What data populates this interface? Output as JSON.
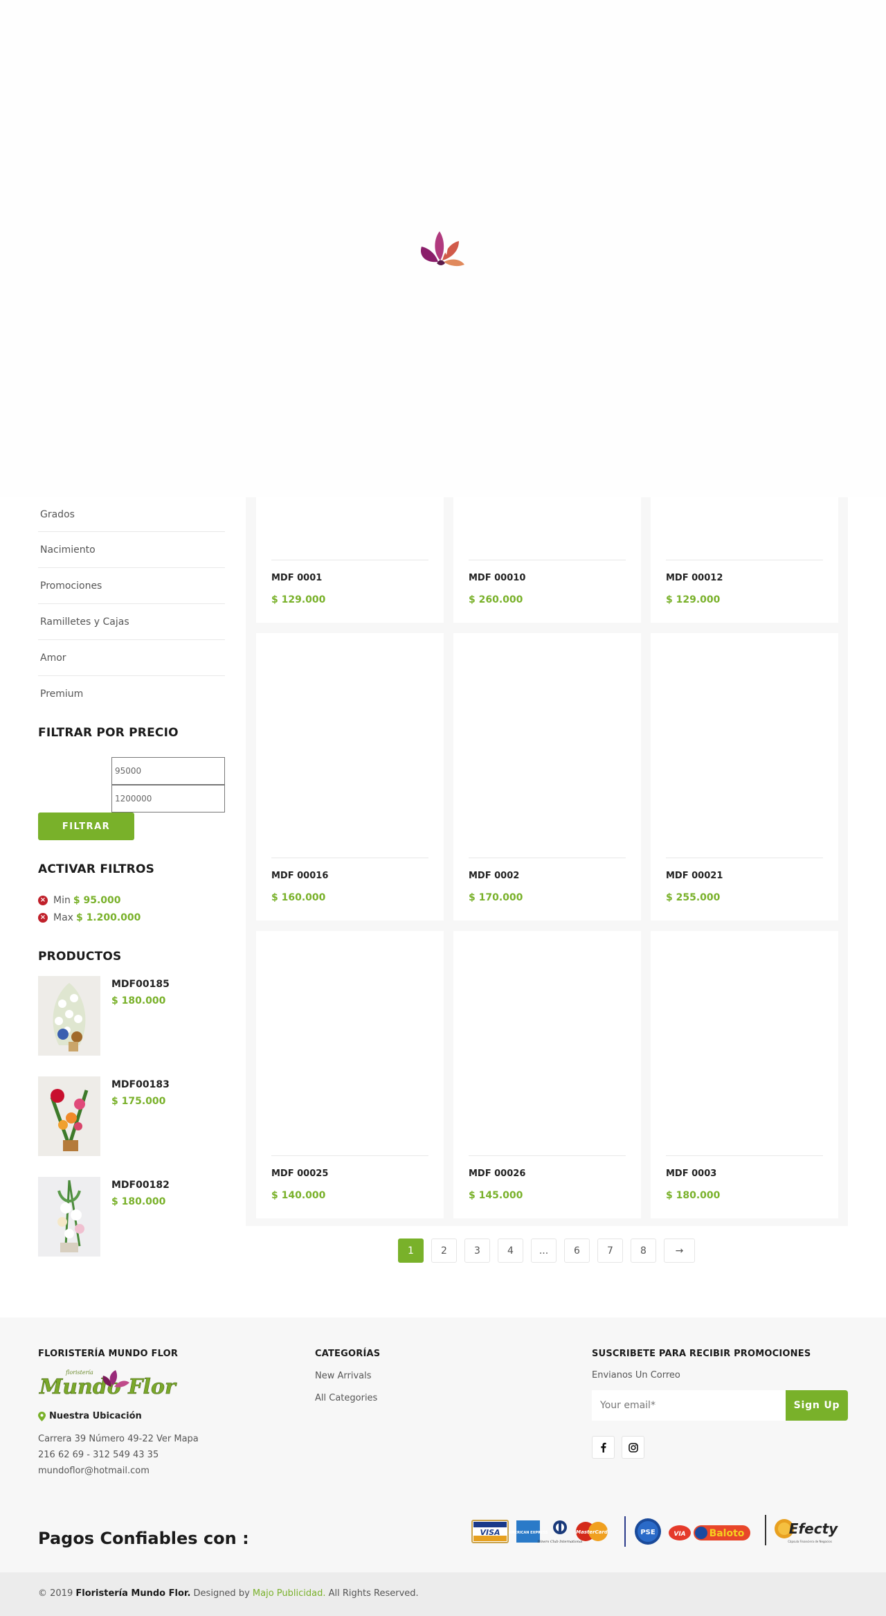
{
  "sidebar": {
    "categories": [
      "Grados",
      "Nacimiento",
      "Promociones",
      "Ramilletes y Cajas",
      "Amor",
      "Premium"
    ],
    "price_filter": {
      "title": "FILTRAR POR PRECIO",
      "min_value": "95000",
      "max_value": "1200000",
      "button_label": "FILTRAR"
    },
    "active_filters": {
      "title": "ACTIVAR FILTROS",
      "items": [
        {
          "label": "Min",
          "value": "$ 95.000"
        },
        {
          "label": "Max",
          "value": "$ 1.200.000"
        }
      ]
    },
    "products": {
      "title": "PRODUCTOS",
      "items": [
        {
          "name": "MDF00185",
          "price": "$ 180.000"
        },
        {
          "name": "MDF00183",
          "price": "$ 175.000"
        },
        {
          "name": "MDF00182",
          "price": "$ 180.000"
        }
      ]
    }
  },
  "grid": {
    "products": [
      {
        "name": "MDF 0001",
        "price": "$ 129.000"
      },
      {
        "name": "MDF 00010",
        "price": "$ 260.000"
      },
      {
        "name": "MDF 00012",
        "price": "$ 129.000"
      },
      {
        "name": "MDF 00016",
        "price": "$ 160.000"
      },
      {
        "name": "MDF 0002",
        "price": "$ 170.000"
      },
      {
        "name": "MDF 00021",
        "price": "$ 255.000"
      },
      {
        "name": "MDF 00025",
        "price": "$ 140.000"
      },
      {
        "name": "MDF 00026",
        "price": "$ 145.000"
      },
      {
        "name": "MDF 0003",
        "price": "$ 180.000"
      }
    ]
  },
  "pagination": {
    "pages": [
      "1",
      "2",
      "3",
      "4",
      "...",
      "6",
      "7",
      "8"
    ],
    "active": "1",
    "next_icon": "arrow-right-icon",
    "next_label": "→"
  },
  "footer": {
    "brand": {
      "title": "FLORISTERÍA MUNDO FLOR",
      "logo_small": "floristería",
      "logo_text": "Mundo Flor",
      "location_label": "Nuestra Ubicación",
      "address": "Carrera 39 Número 49-22 Ver Mapa",
      "phones": "216 62 69 - 312 549 43 35",
      "email": "mundoflor@hotmail.com"
    },
    "categories": {
      "title": "CATEGORÍAS",
      "links": [
        "New Arrivals",
        "All Categories"
      ]
    },
    "subscribe": {
      "title": "SUSCRIBETE PARA RECIBIR PROMOCIONES",
      "subtitle": "Envianos Un Correo",
      "placeholder": "Your email*",
      "button": "Sign Up"
    },
    "social": [
      "facebook-icon",
      "instagram-icon"
    ],
    "payments_title": "Pagos Confiables con :",
    "payment_logos": {
      "visa": "VISA",
      "amex": "AMERICAN EXPRESS",
      "diners": "Diners Club International",
      "mastercard": "MasterCard",
      "pse": "PSE",
      "via": "VIA",
      "baloto": "Baloto",
      "efecty": "Efecty",
      "efecty_tagline": "Cápsula Financiera de Negocios"
    }
  },
  "copyright": {
    "prefix": "© 2019",
    "brand": "Floristería Mundo Flor.",
    "designed_by": "Designed by",
    "designer": "Majo Publicidad.",
    "suffix": "All Rights Reserved."
  },
  "colors": {
    "accent": "#79b12a",
    "remove": "#c0202a"
  }
}
